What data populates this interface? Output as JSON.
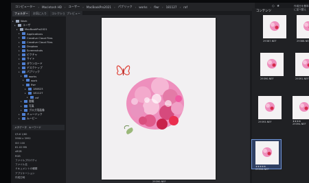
{
  "window": {
    "path": [
      "コンピューター",
      "Macintosh HD",
      "ユーザー",
      "MacBookPro2021",
      "パブリック",
      "works",
      "flwr",
      "181127",
      "raf"
    ]
  },
  "left_panel": {
    "tabs": [
      "フォルダー",
      "お気に入り",
      "コレクション"
    ],
    "preview_tab": "プレビュー",
    "folders": [
      {
        "label": "Work",
        "depth": 0
      },
      {
        "label": "ユーザ",
        "depth": 1
      },
      {
        "label": "MacBookPro2021",
        "depth": 2
      },
      {
        "label": "Applications",
        "depth": 3
      },
      {
        "label": "Creative Cloud Files",
        "depth": 3
      },
      {
        "label": "Creative Cloud Files",
        "depth": 3
      },
      {
        "label": "Dropbox",
        "depth": 3
      },
      {
        "label": "Screenshots",
        "depth": 3
      },
      {
        "label": "ピクチャ",
        "depth": 3
      },
      {
        "label": "サイト",
        "depth": 3
      },
      {
        "label": "ダウンロード",
        "depth": 3
      },
      {
        "label": "デスクトップ",
        "depth": 3
      },
      {
        "label": "パブリック",
        "depth": 3
      },
      {
        "label": "works",
        "depth": 4
      },
      {
        "label": "work",
        "depth": 5
      },
      {
        "label": "flwr",
        "depth": 5
      },
      {
        "label": "180823",
        "depth": 6
      },
      {
        "label": "181127",
        "depth": 6
      },
      {
        "label": "raf",
        "depth": 7
      },
      {
        "label": "書籍",
        "depth": 4
      },
      {
        "label": "写真",
        "depth": 4
      },
      {
        "label": "ブログ用画像",
        "depth": 4
      },
      {
        "label": "ミュージック",
        "depth": 3
      },
      {
        "label": "ムービー",
        "depth": 3
      }
    ],
    "meta_tabs": [
      "メタデータ",
      "キーワード"
    ],
    "meta_rows": [
      "f/5.6 1/60",
      "5984 x 3992",
      "ISO 100",
      "81.02 MB",
      "sRGB",
      "RGB",
      "ファイルプロパティ",
      "ファイル名",
      "ドキュメントの種類",
      "アプリケーション",
      "作成日時"
    ]
  },
  "preview": {
    "filename": "29390.NEF"
  },
  "content": {
    "label": "コンテンツ",
    "sort_label": "作成日を基準に並べ替え",
    "items": [
      {
        "caption": "29387.NEF",
        "stars": ""
      },
      {
        "caption": "29388.NEF",
        "stars": ""
      },
      {
        "caption": "29390.NEF",
        "stars": ""
      },
      {
        "caption": "29391.NEF",
        "stars": ""
      },
      {
        "caption": "29393.NEF",
        "stars": ""
      },
      {
        "caption": "29394.NEF",
        "stars": "★★★★"
      },
      {
        "caption": "29396.NEF",
        "stars": "★★★★★"
      }
    ]
  },
  "colors": {
    "accent": "#4f7fd1",
    "selection": "#2f3f62",
    "flower_pink": "#e66aa8",
    "flower_red": "#d52a4a"
  }
}
